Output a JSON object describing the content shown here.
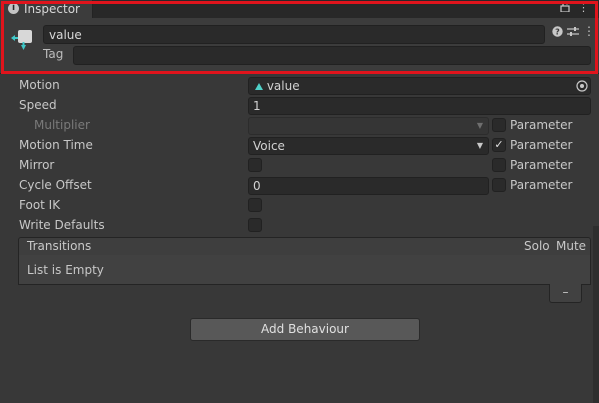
{
  "tab": {
    "title": "Inspector",
    "info_icon": "info-icon",
    "lock_icon": "lock-icon",
    "menu_icon": "kebab-menu-icon"
  },
  "header": {
    "name_value": "value",
    "tag_label": "Tag",
    "tag_value": "",
    "icons": [
      "animator-state-icon",
      "help-icon",
      "preset-sliders-icon",
      "kebab-menu-icon"
    ]
  },
  "properties": {
    "motion": {
      "label": "Motion",
      "value": "value",
      "icon": "blend-tree-icon",
      "picker_icon": "object-picker-icon"
    },
    "speed": {
      "label": "Speed",
      "value": "1"
    },
    "multiplier": {
      "label": "Multiplier",
      "value": "",
      "param_label": "Parameter",
      "param_checked": false
    },
    "motion_time": {
      "label": "Motion Time",
      "value": "Voice",
      "param_label": "Parameter",
      "param_checked": true
    },
    "mirror": {
      "label": "Mirror",
      "checked": false,
      "param_label": "Parameter",
      "param_checked": false
    },
    "cycle_offset": {
      "label": "Cycle Offset",
      "value": "0",
      "param_label": "Parameter",
      "param_checked": false
    },
    "foot_ik": {
      "label": "Foot IK",
      "checked": false
    },
    "write_defaults": {
      "label": "Write Defaults",
      "checked": false
    }
  },
  "transitions": {
    "title": "Transitions",
    "col_solo": "Solo",
    "col_mute": "Mute",
    "empty_text": "List is Empty",
    "remove_label": "–"
  },
  "add_behaviour_label": "Add Behaviour",
  "colors": {
    "highlight": "#e0141c",
    "background": "#383838",
    "field": "#2a2a2a"
  }
}
